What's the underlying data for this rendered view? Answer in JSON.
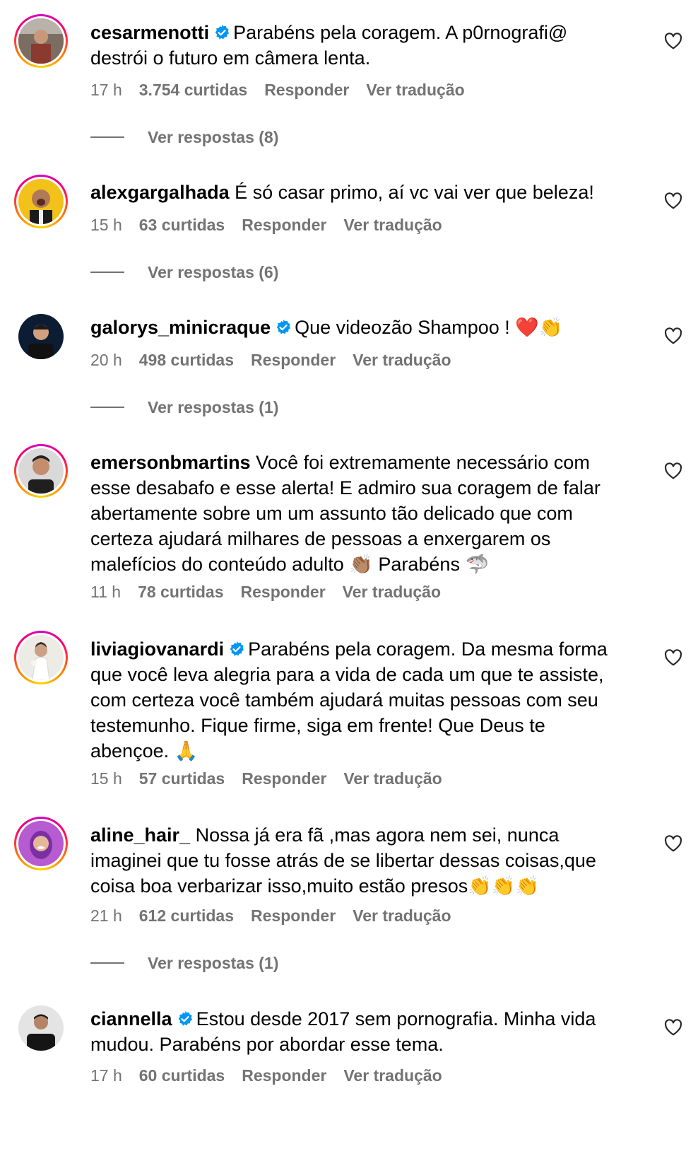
{
  "comments": [
    {
      "username": "cesarmenotti",
      "text": "Parabéns pela coragem. A p0rnografi@ destrói o futuro em câmera lenta.",
      "time": "17 h",
      "likes": "3.754 curtidas",
      "reply_label": "Responder",
      "translate_label": "Ver tradução",
      "replies_label": "Ver respostas (8)"
    },
    {
      "username": "alexgargalhada",
      "text": "É só casar primo, aí vc vai ver que beleza!",
      "time": "15 h",
      "likes": "63 curtidas",
      "reply_label": "Responder",
      "translate_label": "Ver tradução",
      "replies_label": "Ver respostas (6)"
    },
    {
      "username": "galorys_minicraque",
      "text": "Que videozão Shampoo ! ❤️👏",
      "time": "20 h",
      "likes": "498 curtidas",
      "reply_label": "Responder",
      "translate_label": "Ver tradução",
      "replies_label": "Ver respostas (1)"
    },
    {
      "username": "emersonbmartins",
      "text": "Você foi extremamente necessário com esse desabafo e esse alerta! E admiro sua coragem de falar abertamente sobre um um assunto tão delicado que com certeza ajudará milhares de pessoas a enxergarem os malefícios do conteúdo adulto 👏🏽 Parabéns 🦈",
      "time": "11 h",
      "likes": "78 curtidas",
      "reply_label": "Responder",
      "translate_label": "Ver tradução"
    },
    {
      "username": "liviagiovanardi",
      "text": "Parabéns pela coragem. Da mesma forma que você leva alegria para a vida de cada um que te assiste, com certeza você também ajudará muitas pessoas com seu testemunho. Fique firme, siga em frente! Que Deus te abençoe. 🙏",
      "time": "15 h",
      "likes": "57 curtidas",
      "reply_label": "Responder",
      "translate_label": "Ver tradução"
    },
    {
      "username": "aline_hair_",
      "text": "Nossa já era fã ,mas agora nem sei, nunca imaginei que tu fosse atrás de se libertar dessas coisas,que coisa boa verbarizar isso,muito estão presos👏👏👏",
      "time": "21 h",
      "likes": "612 curtidas",
      "reply_label": "Responder",
      "translate_label": "Ver tradução",
      "replies_label": "Ver respostas (1)"
    },
    {
      "username": "ciannella",
      "text": "Estou desde 2017 sem pornografia. Minha vida mudou. Parabéns por abordar esse tema.",
      "time": "17 h",
      "likes": "60 curtidas",
      "reply_label": "Responder",
      "translate_label": "Ver tradução"
    }
  ],
  "colors": {
    "verified": "#0095f6",
    "meta": "#737373",
    "text": "#000000"
  },
  "icons": {
    "verified": "verified-badge-icon",
    "like": "heart-outline-icon"
  }
}
